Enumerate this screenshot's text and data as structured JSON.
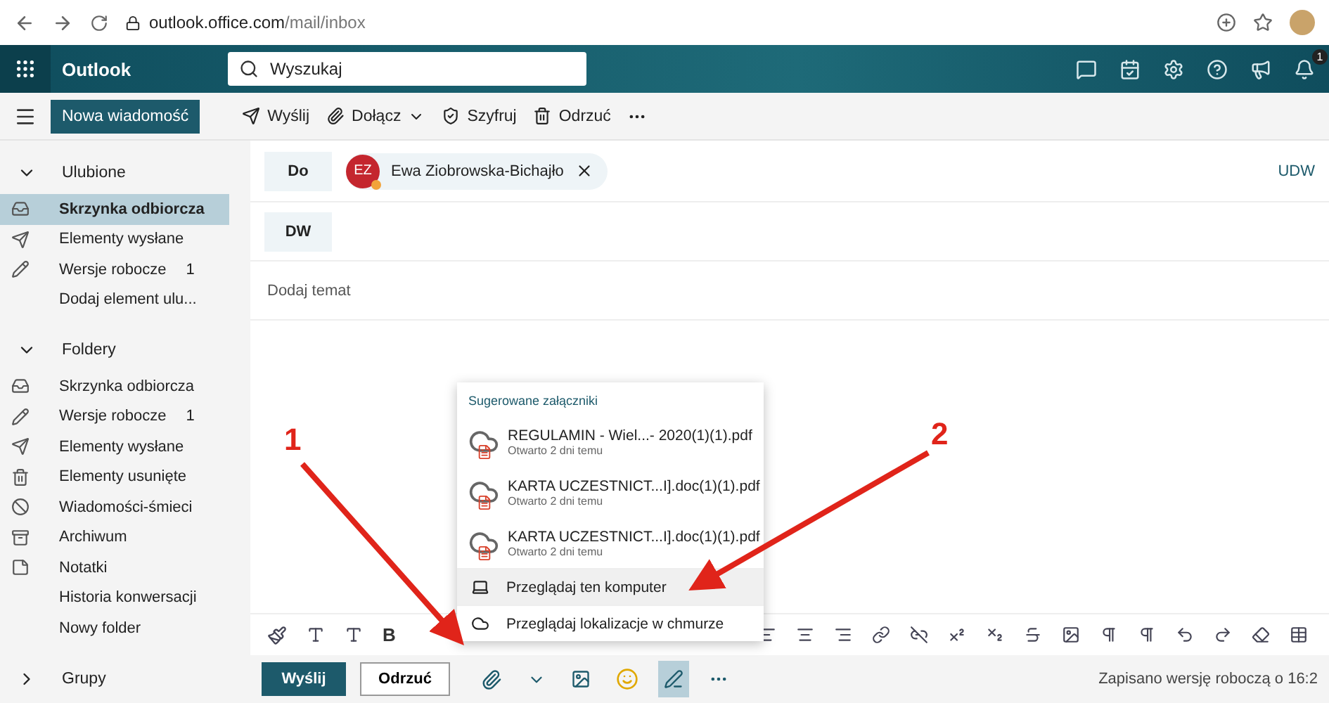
{
  "browser": {
    "host": "outlook.office.com",
    "path": "/mail/inbox"
  },
  "header": {
    "app_name": "Outlook",
    "search_placeholder": "Wyszukaj",
    "notification_count": "1"
  },
  "command_bar": {
    "new_message": "Nowa wiadomość",
    "actions": [
      {
        "label": "Wyślij",
        "kind": "send",
        "has_menu": false
      },
      {
        "label": "Dołącz",
        "kind": "attach",
        "has_menu": true
      },
      {
        "label": "Szyfruj",
        "kind": "encrypt",
        "has_menu": false
      },
      {
        "label": "Odrzuć",
        "kind": "discard",
        "has_menu": false
      }
    ]
  },
  "sidebar": {
    "sections": [
      {
        "title": "Ulubione",
        "expanded": true,
        "items": [
          {
            "label": "Skrzynka odbiorcza",
            "kind": "inbox",
            "selected": true
          },
          {
            "label": "Elementy wysłane",
            "kind": "sent",
            "selected": false
          },
          {
            "label": "Wersje robocze",
            "kind": "drafts",
            "count": "1",
            "selected": false
          },
          {
            "label": "Dodaj element ulu...",
            "kind": "plain",
            "selected": false
          }
        ]
      },
      {
        "title": "Foldery",
        "expanded": true,
        "items": [
          {
            "label": "Skrzynka odbiorcza",
            "kind": "inbox",
            "selected": false
          },
          {
            "label": "Wersje robocze",
            "kind": "drafts",
            "count": "1",
            "selected": false
          },
          {
            "label": "Elementy wysłane",
            "kind": "sent",
            "selected": false
          },
          {
            "label": "Elementy usunięte",
            "kind": "deleted",
            "selected": false
          },
          {
            "label": "Wiadomości-śmieci",
            "kind": "junk",
            "selected": false
          },
          {
            "label": "Archiwum",
            "kind": "archive",
            "selected": false
          },
          {
            "label": "Notatki",
            "kind": "notes",
            "selected": false
          },
          {
            "label": "Historia konwersacji",
            "kind": "plain",
            "selected": false
          },
          {
            "label": "Nowy folder",
            "kind": "plain",
            "selected": false
          }
        ]
      },
      {
        "title": "Grupy",
        "expanded": false
      }
    ]
  },
  "compose": {
    "to_label": "Do",
    "recipient": {
      "initials": "EZ",
      "name": "Ewa Ziobrowska-Bichajło"
    },
    "bcc_link": "UDW",
    "cc_label": "DW",
    "subject_placeholder": "Dodaj temat"
  },
  "attach_menu": {
    "heading": "Sugerowane załączniki",
    "files": [
      {
        "name": "REGULAMIN - Wiel...- 2020(1)(1).pdf",
        "opened": "Otwarto 2 dni temu"
      },
      {
        "name": "KARTA UCZESTNICT...I].doc(1)(1).pdf",
        "opened": "Otwarto 2 dni temu"
      },
      {
        "name": "KARTA UCZESTNICT...I].doc(1)(1).pdf",
        "opened": "Otwarto 2 dni temu"
      }
    ],
    "actions": [
      {
        "label": "Przeglądaj ten komputer",
        "kind": "computer",
        "selected": true
      },
      {
        "label": "Przeglądaj lokalizacje w chmurze",
        "kind": "cloud",
        "selected": false
      }
    ]
  },
  "format_toolbar": {
    "bold": "B"
  },
  "footer": {
    "send": "Wyślij",
    "discard": "Odrzuć",
    "status": "Zapisano wersję roboczą o 16:2",
    "draw_active": true
  },
  "annotations": [
    {
      "label": "1"
    },
    {
      "label": "2"
    }
  ]
}
